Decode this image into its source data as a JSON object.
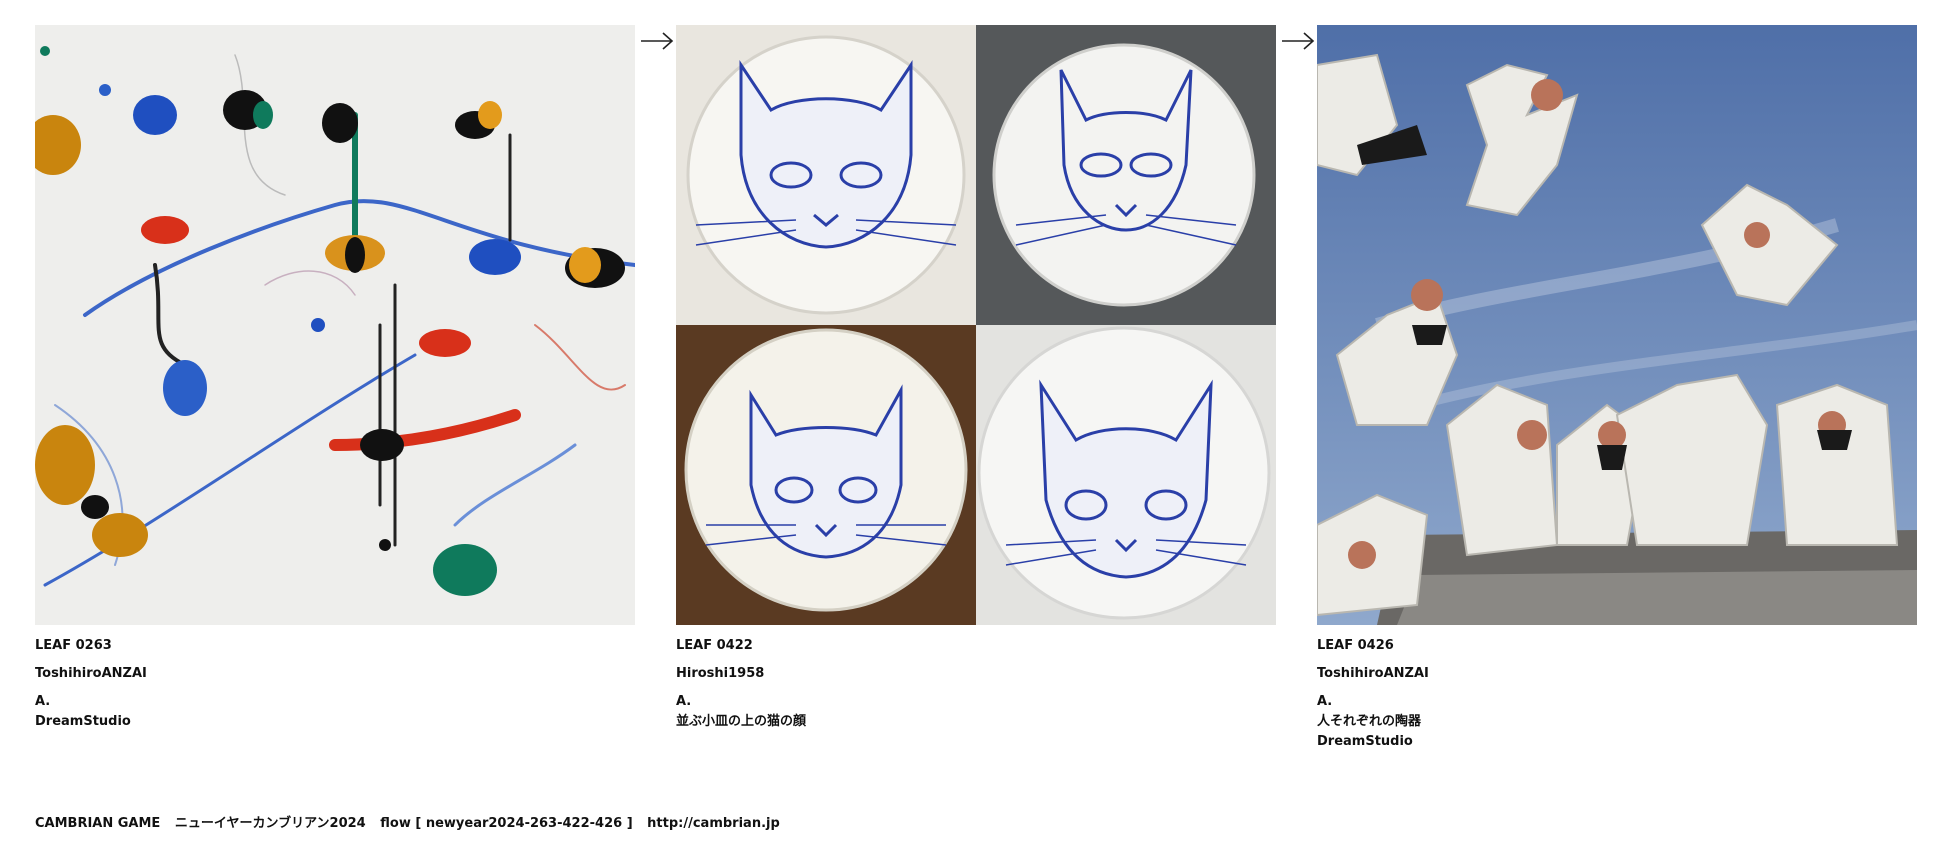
{
  "works": [
    {
      "leaf": "LEAF 0263",
      "author": "ToshihiroANZAI",
      "answer": "A.",
      "desc": "",
      "tool": "DreamStudio",
      "image": "abstract-drip-painting"
    },
    {
      "leaf": "LEAF 0422",
      "author": "Hiroshi1958",
      "answer": "A.",
      "desc": "並ぶ小皿の上の猫の顔",
      "tool": "",
      "image": "blue-cat-plates-grid"
    },
    {
      "leaf": "LEAF 0426",
      "author": "ToshihiroANZAI",
      "answer": "A.",
      "desc": "人それぞれの陶器",
      "tool": "DreamStudio",
      "image": "porcelain-figures-sky"
    }
  ],
  "footer": {
    "brand": "CAMBRIAN GAME",
    "event": "ニューイヤーカンブリアン2024",
    "flow": "flow [ newyear2024-263-422-426 ]",
    "url": "http://cambrian.jp"
  },
  "colors": {
    "plate_blue": "#2a3fa8",
    "sky_blue": "#5f7fb3",
    "paint_red": "#d8301a",
    "paint_green": "#0f7a5c",
    "paint_ochre": "#c9850e"
  }
}
